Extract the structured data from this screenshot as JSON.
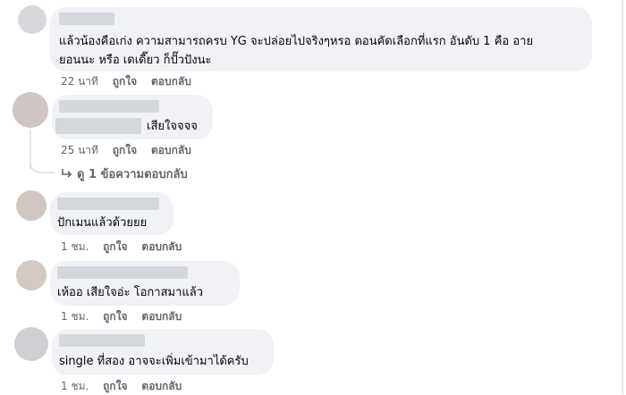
{
  "comments": [
    {
      "text_lines": [
        "แล้วน้องคือเก่ง ความสามารถครบ YG จะปล่อยไปจริงๆหรอ ตอนคัดเลือกที่แรก อันดับ 1 คือ อาย",
        "ยอนนะ หรือ เดเดี๊ยว ก็ปั๊วปังนะ"
      ],
      "time": "22 นาที",
      "like": "ถูกใจ",
      "reply": "ตอบกลับ"
    },
    {
      "text": "เสียใจจจจ",
      "time": "25 นาที",
      "like": "ถูกใจ",
      "reply": "ตอบกลับ",
      "view_replies": "ดู 1 ข้อความตอบกลับ"
    },
    {
      "text": "ปักเมนแล้วด้วยยย",
      "time": "1 ชม.",
      "like": "ถูกใจ",
      "reply": "ตอบกลับ"
    },
    {
      "text": "เห้ออ เสียใจอ่ะ โอกาสมาแล้ว",
      "time": "1 ชม.",
      "like": "ถูกใจ",
      "reply": "ตอบกลับ"
    },
    {
      "text": "single ที่สอง อาจจะเพิ่มเข้ามาได้ครับ",
      "time": "1 ชม.",
      "like": "ถูกใจ",
      "reply": "ตอบกลับ"
    }
  ],
  "icons": {
    "reply_arrow": "reply-arrow-icon"
  }
}
